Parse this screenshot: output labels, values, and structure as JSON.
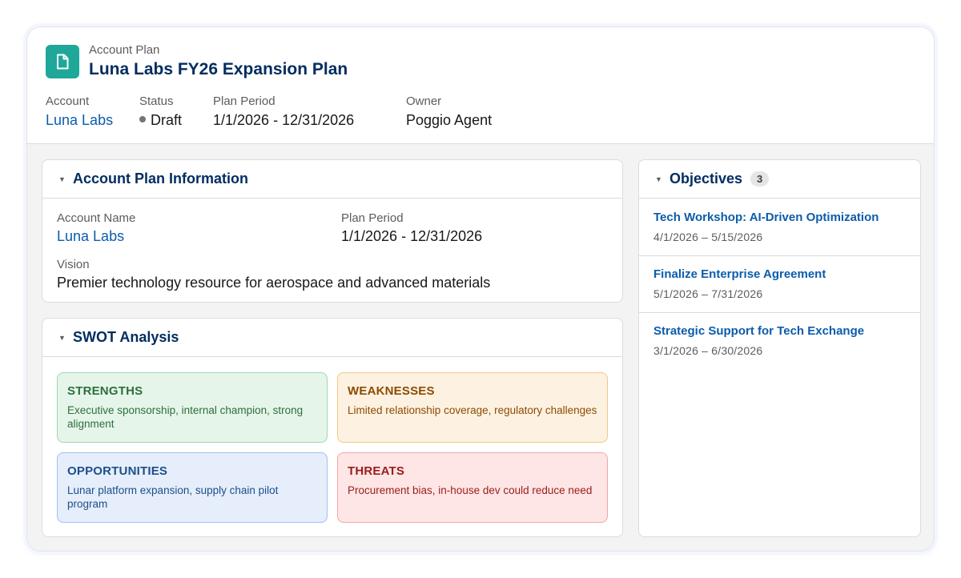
{
  "header": {
    "eyebrow": "Account Plan",
    "title": "Luna Labs FY26 Expansion Plan",
    "icon": "document-icon",
    "fields": {
      "account_label": "Account",
      "account_value": "Luna Labs",
      "status_label": "Status",
      "status_value": "Draft",
      "period_label": "Plan Period",
      "period_value": "1/1/2026 - 12/31/2026",
      "owner_label": "Owner",
      "owner_value": "Poggio Agent"
    }
  },
  "info_card": {
    "title": "Account Plan Information",
    "account_name_label": "Account Name",
    "account_name_value": "Luna Labs",
    "plan_period_label": "Plan Period",
    "plan_period_value": "1/1/2026 - 12/31/2026",
    "vision_label": "Vision",
    "vision_value": "Premier technology resource for aerospace and advanced materials"
  },
  "swot_card": {
    "title": "SWOT Analysis",
    "strengths": {
      "heading": "STRENGTHS",
      "text": "Executive sponsorship, internal champion, strong alignment"
    },
    "weaknesses": {
      "heading": "WEAKNESSES",
      "text": "Limited relationship coverage, regulatory challenges"
    },
    "opportunities": {
      "heading": "OPPORTUNITIES",
      "text": "Lunar platform expansion, supply chain pilot program"
    },
    "threats": {
      "heading": "THREATS",
      "text": "Procurement bias, in-house dev could reduce need"
    }
  },
  "objectives_card": {
    "title": "Objectives",
    "count": "3",
    "items": [
      {
        "title": "Tech Workshop: AI-Driven Optimization",
        "dates": "4/1/2026 – 5/15/2026"
      },
      {
        "title": "Finalize Enterprise Agreement",
        "dates": "5/1/2026 – 7/31/2026"
      },
      {
        "title": "Strategic Support for Tech Exchange",
        "dates": "3/1/2026 – 6/30/2026"
      }
    ]
  },
  "colors": {
    "brand_icon": "#1fa79a",
    "title_navy": "#032d60",
    "link_blue": "#0b5cab"
  }
}
